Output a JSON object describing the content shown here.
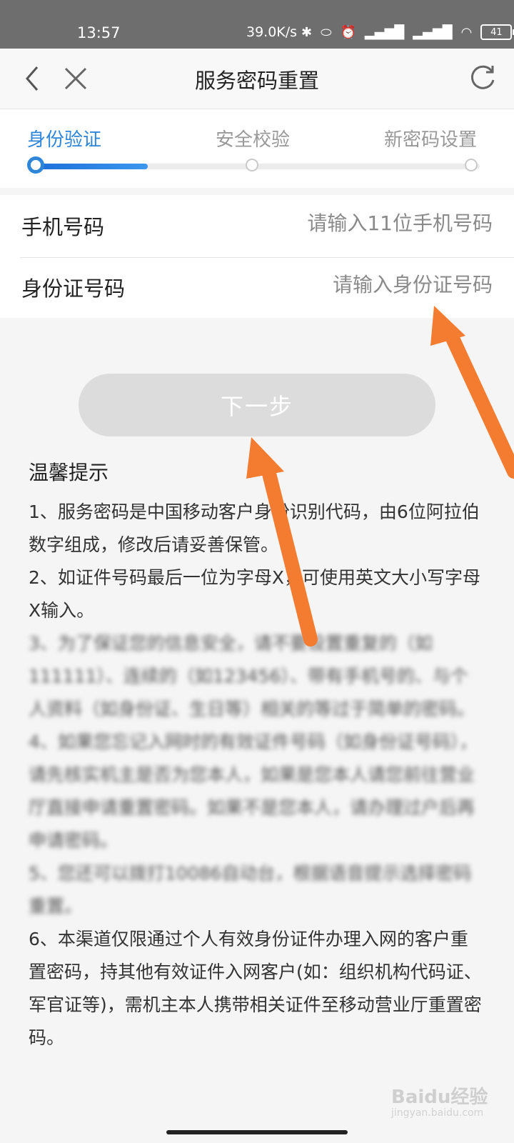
{
  "status_bar": {
    "time": "13:57",
    "net_speed": "39.0K/s",
    "battery": "41"
  },
  "nav": {
    "title": "服务密码重置"
  },
  "steps": [
    {
      "label": "身份验证",
      "active": true
    },
    {
      "label": "安全校验",
      "active": false
    },
    {
      "label": "新密码设置",
      "active": false
    }
  ],
  "progress": 0.25,
  "form": {
    "phone": {
      "label": "手机号码",
      "placeholder": "请输入11位手机号码"
    },
    "id_number": {
      "label": "身份证号码",
      "placeholder": "请输入身份证号码"
    }
  },
  "next_button": "下一步",
  "tips": {
    "heading": "温馨提示",
    "items": [
      "1、服务密码是中国移动客户身份识别代码，由6位阿拉伯数字组成，修改后请妥善保管。",
      "2、如证件号码最后一位为字母X，可使用英文大小写字母X输入。",
      "3、为了保证您的信息安全，请不要设置重复的（如111111）、连续的（如123456）、带有手机号的、与个人资料（如身份证、生日等）相关的等过于简单的密码。",
      "4、如果您忘记入网时的有效证件号码（如身份证号码），请先核实机主是否为您本人，如果是您本人请您前往营业厅直接申请重置密码。如果不是您本人，请办理过户后再申请密码。",
      "5、您还可以拨打10086自动台，根据语音提示选择密码重置。",
      "6、本渠道仅限通过个人有效身份证件办理入网的客户重置密码，持其他有效证件入网客户(如：组织机构代码证、军官证等)，需机主本人携带相关证件至移动营业厅重置密码。"
    ]
  },
  "watermark": {
    "main": "Baidu经验",
    "sub": "jingyan.baidu.com"
  },
  "colors": {
    "accent": "#2f86d8",
    "arrow": "#f47c30",
    "button_disabled": "#dcdcdc"
  }
}
